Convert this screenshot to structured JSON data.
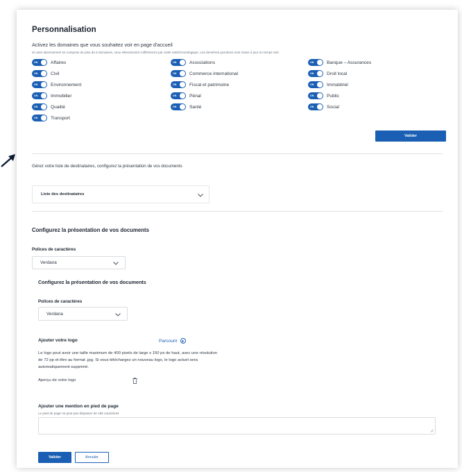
{
  "header": {
    "title": "Personnalisation",
    "subtitle": "Activez les domaines que vous souhaitez voir en page d'accueil",
    "note": "Si votre abonnement se compose de plus de 5 domaines, ceux sélectionnés s'afficheront par ordre antéchronologique. Les dernières parutions sont mises à jour en temps réel."
  },
  "toggle_on_text": "ON",
  "domains": [
    {
      "label": "Affaires",
      "on": true
    },
    {
      "label": "Associations",
      "on": true
    },
    {
      "label": "Banque – Assurances",
      "on": true
    },
    {
      "label": "Civil",
      "on": true
    },
    {
      "label": "Commerce international",
      "on": true
    },
    {
      "label": "Droit local",
      "on": true
    },
    {
      "label": "Environnement",
      "on": true
    },
    {
      "label": "Fiscal et patrimoine",
      "on": true
    },
    {
      "label": "Immatériel",
      "on": true
    },
    {
      "label": "Immobilier",
      "on": true
    },
    {
      "label": "Pénal",
      "on": true
    },
    {
      "label": "Public",
      "on": true
    },
    {
      "label": "Qualité",
      "on": true
    },
    {
      "label": "Santé",
      "on": true
    },
    {
      "label": "Social",
      "on": true
    },
    {
      "label": "Transport",
      "on": true
    }
  ],
  "buttons": {
    "valider": "Valider",
    "annuler": "Annuler"
  },
  "recipients": {
    "intro": "Gérez votre liste de destinataires, configurez la présentation de vos documents",
    "accordion_label": "Liste des destinataires"
  },
  "presentation": {
    "heading": "Configurez la présentation de vos documents",
    "font_label": "Polices de caractères",
    "font_value": "Verdana"
  },
  "presentation_nested": {
    "heading": "Configurez la présentation de vos documents",
    "font_label": "Polices de caractères",
    "font_value": "Verdana"
  },
  "logo": {
    "heading": "Ajouter votre logo",
    "browse": "Parcourir",
    "description": "Le logo peut avoir une taille maximum de 400 pixels de large x 150 px de haut, avec une résolution de 72 pp et être au format .jpg. Si vous téléchargez un nouveau logo, le logo actuel sera automatiquement supprimé.",
    "preview_label": "Aperçu de votre logo"
  },
  "footer_mention": {
    "heading": "Ajouter une mention en pied de page",
    "hint": "Le pied de page ne peut pas dépasser de 185 caractères",
    "value": ""
  },
  "colors": {
    "primary": "#1a5fb4",
    "text": "#1b2430",
    "border": "#d9dce0"
  }
}
